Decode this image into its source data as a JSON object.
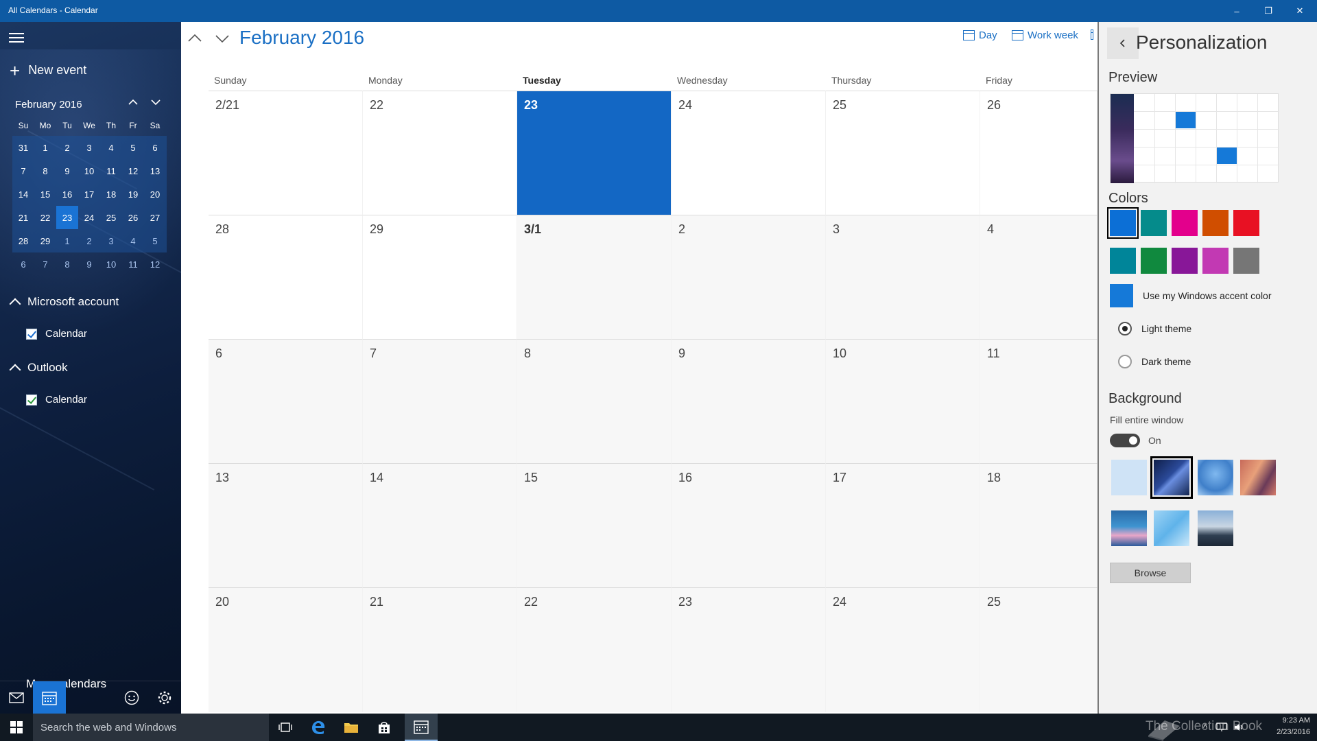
{
  "window": {
    "title": "All Calendars - Calendar",
    "minimize": "–",
    "maximize": "❐",
    "close": "✕"
  },
  "sidebar": {
    "new_event": "New event",
    "mini_calendar": {
      "title": "February 2016",
      "dow": [
        "Su",
        "Mo",
        "Tu",
        "We",
        "Th",
        "Fr",
        "Sa"
      ],
      "weeks": [
        [
          "31",
          "1",
          "2",
          "3",
          "4",
          "5",
          "6"
        ],
        [
          "7",
          "8",
          "9",
          "10",
          "11",
          "12",
          "13"
        ],
        [
          "14",
          "15",
          "16",
          "17",
          "18",
          "19",
          "20"
        ],
        [
          "21",
          "22",
          "23",
          "24",
          "25",
          "26",
          "27"
        ],
        [
          "28",
          "29",
          "1",
          "2",
          "3",
          "4",
          "5"
        ],
        [
          "6",
          "7",
          "8",
          "9",
          "10",
          "11",
          "12"
        ]
      ],
      "today": "23"
    },
    "accounts": [
      {
        "name": "Microsoft account",
        "calendar": "Calendar",
        "color": "#1e6fd0"
      },
      {
        "name": "Outlook",
        "calendar": "Calendar",
        "color": "#2b9a3a"
      }
    ],
    "more_calendars": "More calendars",
    "footer_icons": [
      "mail-icon",
      "calendar-icon",
      "feedback-smiley-icon",
      "settings-gear-icon"
    ]
  },
  "main": {
    "month_title": "February 2016",
    "views": {
      "day": "Day",
      "work_week": "Work week"
    },
    "weekdays": [
      "Sunday",
      "Monday",
      "Tuesday",
      "Wednesday",
      "Thursday",
      "Friday"
    ],
    "current_weekday": "Tuesday",
    "weeks": [
      [
        "2/21",
        "22",
        "23",
        "24",
        "25",
        "26"
      ],
      [
        "28",
        "29",
        "3/1",
        "2",
        "3",
        "4"
      ],
      [
        "6",
        "7",
        "8",
        "9",
        "10",
        "11"
      ],
      [
        "13",
        "14",
        "15",
        "16",
        "17",
        "18"
      ],
      [
        "20",
        "21",
        "22",
        "23",
        "24",
        "25"
      ]
    ],
    "today": "23"
  },
  "panel": {
    "title": "Personalization",
    "preview_label": "Preview",
    "colors_label": "Colors",
    "color_swatches": [
      "#0c6fd6",
      "#058b8b",
      "#e3008c",
      "#d04e00",
      "#e81123",
      "#008599",
      "#10893e",
      "#881798",
      "#c239b3",
      "#767676"
    ],
    "selected_color": "#0c6fd6",
    "accent_label": "Use my Windows accent color",
    "accent_color": "#1579d8",
    "light_theme": "Light theme",
    "dark_theme": "Dark theme",
    "background_label": "Background",
    "fill_label": "Fill entire window",
    "fill_state": "On",
    "browse": "Browse"
  },
  "taskbar": {
    "search_placeholder": "Search the web and Windows",
    "time": "9:23 AM",
    "date": "2/23/2016",
    "watermark": "The Collection Book"
  }
}
